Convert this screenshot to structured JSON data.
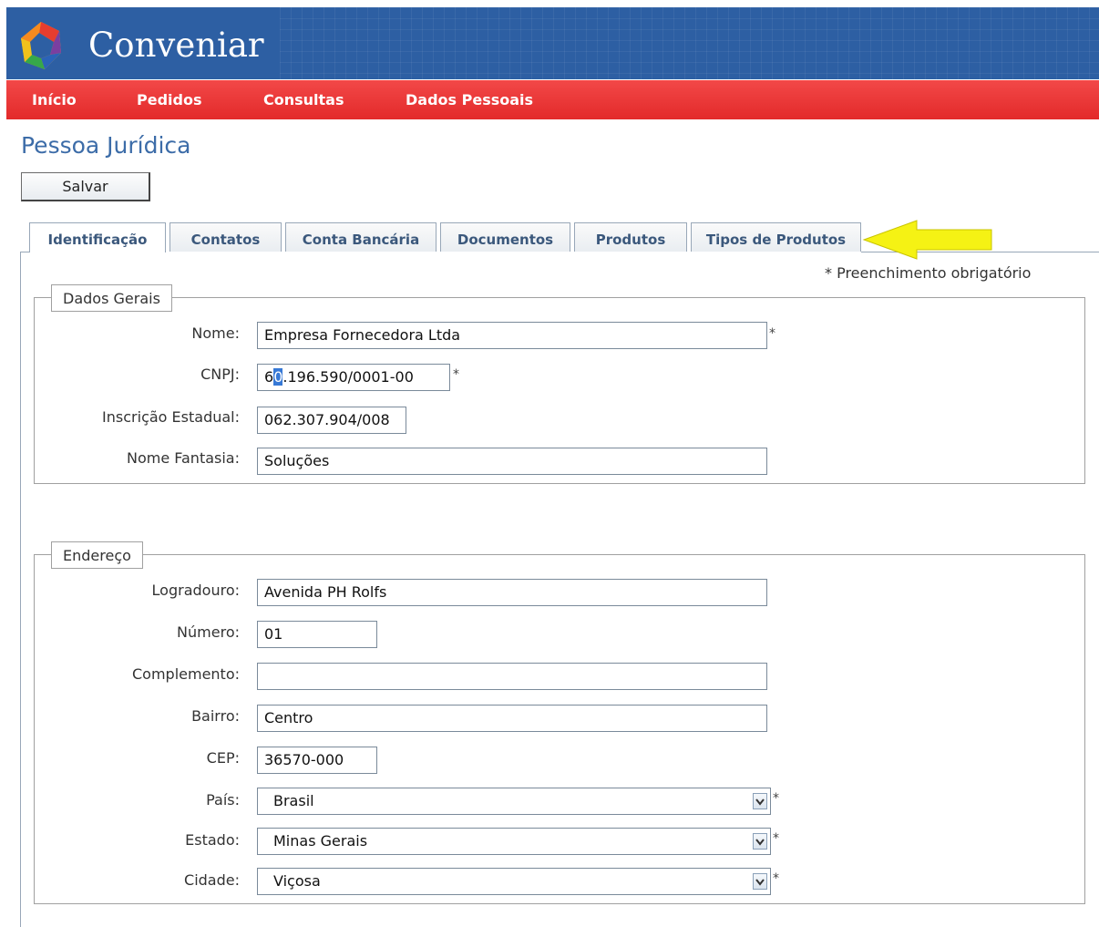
{
  "app": {
    "title": "Conveniar"
  },
  "menu": {
    "items": [
      "Início",
      "Pedidos",
      "Consultas",
      "Dados Pessoais"
    ]
  },
  "page": {
    "title": "Pessoa Jurídica",
    "save_label": "Salvar",
    "required_note": "* Preenchimento obrigatório"
  },
  "tabs": [
    "Identificação",
    "Contatos",
    "Conta Bancária",
    "Documentos",
    "Produtos",
    "Tipos de Produtos"
  ],
  "dados_gerais": {
    "legend": "Dados Gerais",
    "fields": [
      {
        "label": "Nome:",
        "value": "Empresa Fornecedora Ltda",
        "required": "*"
      },
      {
        "label": "CNPJ:",
        "value_prefix": "6",
        "value_cursor": "0",
        "value_rest": ".196.590/0001-00",
        "required": "*"
      },
      {
        "label": "Inscrição Estadual:",
        "value": "062.307.904/008"
      },
      {
        "label": "Nome Fantasia:",
        "value": "Soluções"
      }
    ]
  },
  "endereco": {
    "legend": "Endereço",
    "fields": [
      {
        "label": "Logradouro:",
        "value": "Avenida PH Rolfs"
      },
      {
        "label": "Número:",
        "value": "01"
      },
      {
        "label": "Complemento:",
        "value": ""
      },
      {
        "label": "Bairro:",
        "value": "Centro"
      },
      {
        "label": "CEP:",
        "value": "36570-000"
      },
      {
        "label": "País:",
        "value": "Brasil",
        "required": "*"
      },
      {
        "label": "Estado:",
        "value": "Minas Gerais",
        "required": "*"
      },
      {
        "label": "Cidade:",
        "value": "Viçosa",
        "required": "*"
      }
    ]
  },
  "colors": {
    "header_blue": "#2d5fa3",
    "menu_red": "#ee3a3a",
    "title_blue": "#3c6ca8",
    "annotation_arrow": "#f5f214"
  },
  "icons": {
    "logo": "conveniar-logo-icon",
    "select": "chevron-down-icon",
    "annotation": "yellow-arrow-icon"
  }
}
